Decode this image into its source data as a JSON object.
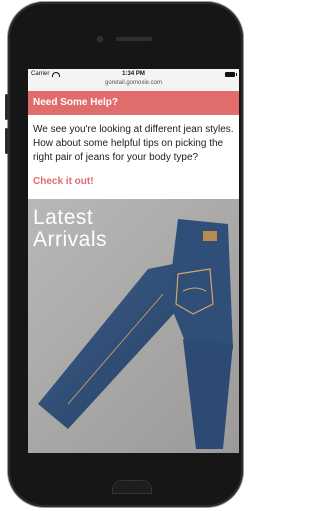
{
  "status_bar": {
    "carrier": "Carrier",
    "time": "1:34 PM",
    "url": "goretail.gomoxie.com"
  },
  "help": {
    "title": "Need Some Help?",
    "message": "We see you're looking at different jean styles. How about some helpful tips on picking the right pair of jeans for your body type?",
    "link_label": "Check it out!"
  },
  "hero": {
    "title_line1": "Latest",
    "title_line2": "Arrivals"
  },
  "colors": {
    "accent": "#e06c6c",
    "denim": "#2f4e78"
  }
}
